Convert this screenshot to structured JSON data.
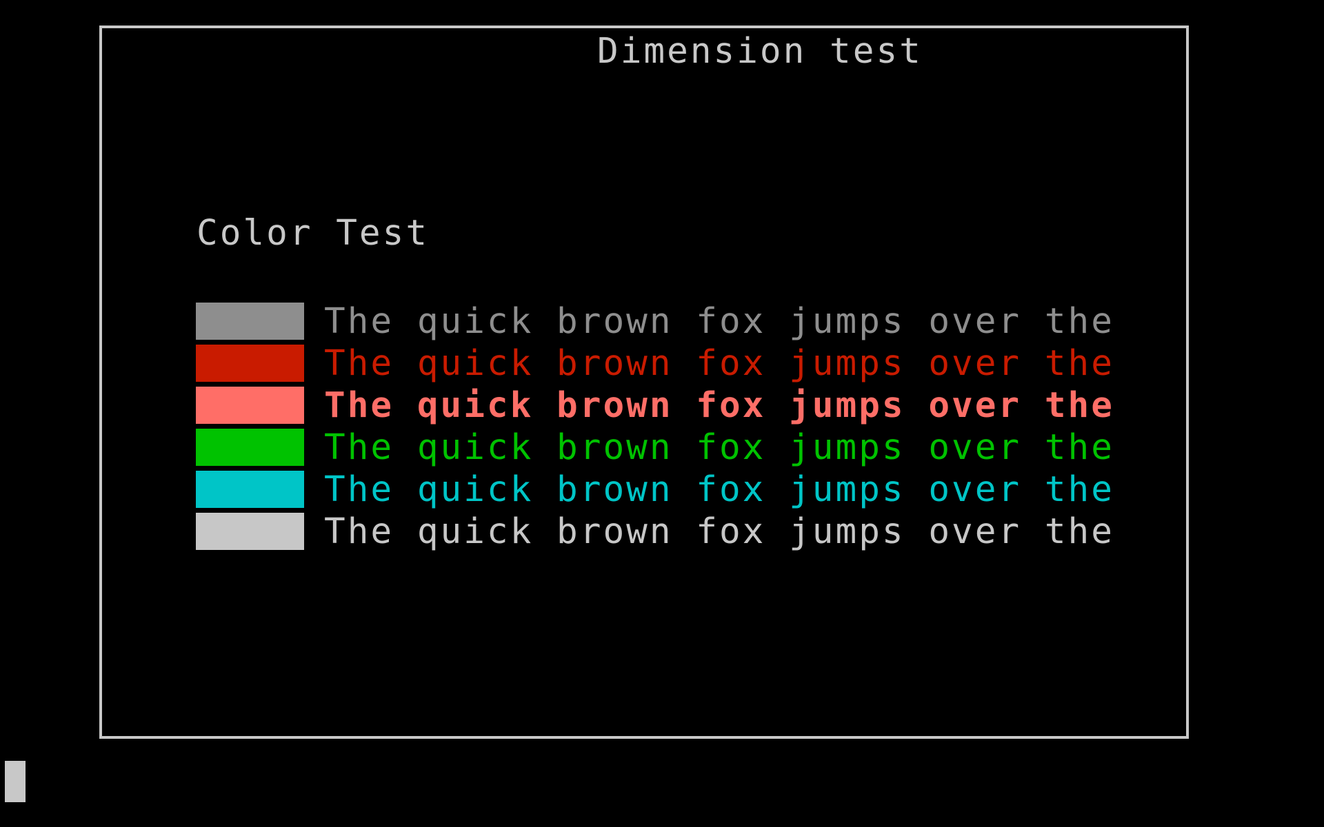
{
  "window": {
    "title": "Dimension test"
  },
  "section": {
    "title": "Color Test"
  },
  "rows": [
    {
      "swatch_color": "#8e8e8e",
      "text_color": "#8e8e8e",
      "bold": false,
      "text": "The quick brown fox jumps over the"
    },
    {
      "swatch_color": "#c91b00",
      "text_color": "#c91b00",
      "bold": false,
      "text": "The quick brown fox jumps over the"
    },
    {
      "swatch_color": "#ff6e67",
      "text_color": "#ff6e67",
      "bold": true,
      "text": "The quick brown fox jumps over the"
    },
    {
      "swatch_color": "#00c200",
      "text_color": "#00c200",
      "bold": false,
      "text": "The quick brown fox jumps over the"
    },
    {
      "swatch_color": "#00c5c7",
      "text_color": "#00c5c7",
      "bold": false,
      "text": "The quick brown fox jumps over the"
    },
    {
      "swatch_color": "#c7c7c7",
      "text_color": "#c7c7c7",
      "bold": false,
      "text": "The quick brown fox jumps over the"
    }
  ],
  "colors": {
    "background": "#000000",
    "border": "#c8c8c8",
    "cursor": "#c8c8c8"
  }
}
